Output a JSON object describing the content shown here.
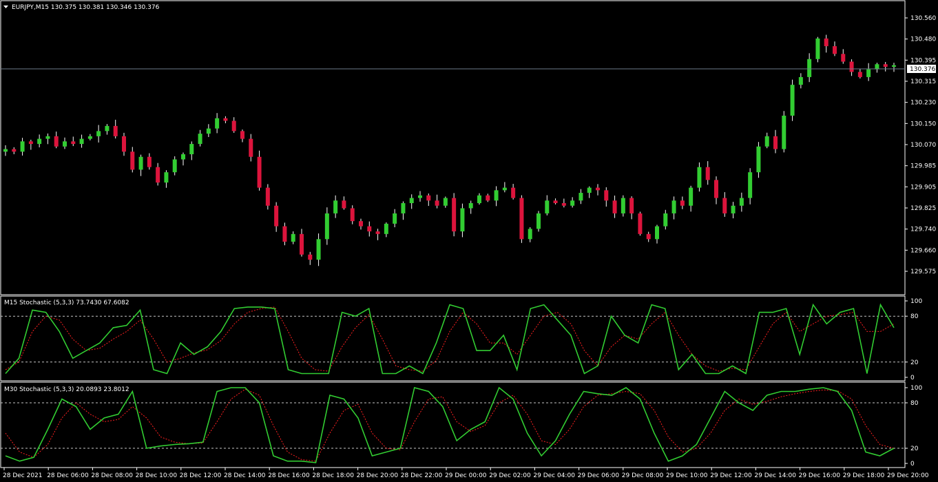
{
  "main_panel": {
    "title": "EURJPY,M15  130.375 130.381 130.346 130.376",
    "price_ticks": [
      "130.560",
      "130.480",
      "130.395",
      "130.315",
      "130.230",
      "130.150",
      "130.070",
      "129.985",
      "129.905",
      "129.825",
      "129.740",
      "129.660",
      "129.575"
    ],
    "current_price_label": "130.376"
  },
  "stoch_m15": {
    "title": "M15 Stochastic (5,3,3) 73.7430 67.6082",
    "levels": [
      "100",
      "80",
      "20",
      "0"
    ]
  },
  "stoch_m30": {
    "title": "M30 Stochastic (5,3,3) 20.0893 23.8012",
    "levels": [
      "100",
      "80",
      "20",
      "0"
    ]
  },
  "time_axis": [
    "28 Dec 2021",
    "28 Dec 06:00",
    "28 Dec 08:00",
    "28 Dec 10:00",
    "28 Dec 12:00",
    "28 Dec 14:00",
    "28 Dec 16:00",
    "28 Dec 18:00",
    "28 Dec 20:00",
    "28 Dec 22:00",
    "29 Dec 00:00",
    "29 Dec 02:00",
    "29 Dec 04:00",
    "29 Dec 06:00",
    "29 Dec 08:00",
    "29 Dec 10:00",
    "29 Dec 12:00",
    "29 Dec 14:00",
    "29 Dec 16:00",
    "29 Dec 18:00",
    "29 Dec 20:00"
  ],
  "colors": {
    "background": "#000000",
    "frame": "#ffffff",
    "grid": "#3a3f4e",
    "bull": "#32cd32",
    "bear": "#dc143c",
    "stoch_main": "#32cd32",
    "stoch_signal": "#ff2020"
  },
  "chart_data": {
    "type": "candlestick",
    "symbol": "EURJPY",
    "timeframe": "M15",
    "ohlc_close_path": [
      130.05,
      130.04,
      130.08,
      130.07,
      130.09,
      130.1,
      130.06,
      130.08,
      130.07,
      130.09,
      130.1,
      130.12,
      130.14,
      130.1,
      130.04,
      129.97,
      130.02,
      129.98,
      129.92,
      129.96,
      130.01,
      130.03,
      130.07,
      130.11,
      130.13,
      130.17,
      130.16,
      130.12,
      130.09,
      130.02,
      129.9,
      129.83,
      129.75,
      129.69,
      129.72,
      129.64,
      129.62,
      129.7,
      129.8,
      129.85,
      129.82,
      129.77,
      129.75,
      129.73,
      129.72,
      129.76,
      129.8,
      129.84,
      129.86,
      129.87,
      129.85,
      129.83,
      129.86,
      129.73,
      129.82,
      129.84,
      129.87,
      129.85,
      129.89,
      129.9,
      129.86,
      129.7,
      129.74,
      129.8,
      129.85,
      129.84,
      129.83,
      129.85,
      129.88,
      129.9,
      129.89,
      129.85,
      129.8,
      129.86,
      129.8,
      129.72,
      129.7,
      129.75,
      129.8,
      129.85,
      129.83,
      129.9,
      129.98,
      129.93,
      129.86,
      129.8,
      129.83,
      129.86,
      129.96,
      130.06,
      130.1,
      130.05,
      130.18,
      130.3,
      130.33,
      130.4,
      130.48,
      130.45,
      130.42,
      130.39,
      130.35,
      130.33,
      130.36,
      130.38,
      130.37,
      130.376
    ],
    "price_range": [
      129.575,
      130.56
    ],
    "stoch_m15_main": [
      5,
      25,
      88,
      85,
      60,
      25,
      35,
      45,
      65,
      68,
      88,
      10,
      5,
      45,
      30,
      40,
      60,
      90,
      92,
      92,
      90,
      10,
      5,
      5,
      5,
      85,
      80,
      90,
      5,
      5,
      15,
      5,
      45,
      95,
      90,
      35,
      35,
      55,
      10,
      90,
      95,
      75,
      55,
      5,
      15,
      80,
      55,
      45,
      95,
      90,
      10,
      30,
      5,
      5,
      15,
      5,
      85,
      85,
      90,
      30,
      95,
      70,
      85,
      90,
      5,
      95,
      65
    ],
    "stoch_m15_signal": [
      10,
      20,
      60,
      80,
      75,
      50,
      35,
      38,
      50,
      60,
      75,
      50,
      20,
      25,
      32,
      36,
      48,
      70,
      85,
      90,
      92,
      60,
      25,
      10,
      8,
      40,
      65,
      82,
      50,
      15,
      10,
      8,
      22,
      60,
      85,
      70,
      45,
      45,
      30,
      55,
      80,
      85,
      70,
      35,
      15,
      40,
      55,
      50,
      70,
      85,
      55,
      30,
      15,
      8,
      12,
      10,
      40,
      70,
      85,
      60,
      70,
      80,
      82,
      85,
      60,
      60,
      70
    ],
    "stoch_m30_main": [
      10,
      3,
      8,
      45,
      85,
      75,
      45,
      60,
      65,
      95,
      20,
      23,
      25,
      26,
      28,
      95,
      100,
      100,
      80,
      10,
      3,
      3,
      1,
      90,
      85,
      60,
      10,
      15,
      20,
      100,
      95,
      75,
      30,
      45,
      55,
      100,
      85,
      40,
      10,
      30,
      65,
      95,
      92,
      90,
      100,
      85,
      40,
      3,
      10,
      25,
      60,
      95,
      80,
      70,
      90,
      95,
      95,
      98,
      100,
      95,
      70,
      15,
      10,
      20
    ],
    "stoch_m30_signal": [
      40,
      15,
      8,
      25,
      60,
      80,
      65,
      55,
      58,
      75,
      60,
      35,
      28,
      26,
      27,
      55,
      85,
      98,
      90,
      50,
      15,
      5,
      3,
      40,
      70,
      78,
      40,
      20,
      18,
      55,
      85,
      88,
      55,
      42,
      50,
      80,
      90,
      65,
      30,
      25,
      45,
      75,
      90,
      92,
      95,
      92,
      70,
      35,
      15,
      20,
      40,
      70,
      85,
      78,
      82,
      88,
      92,
      95,
      97,
      96,
      85,
      50,
      25,
      20
    ],
    "stoch_params": "(5,3,3)",
    "levels": [
      20,
      80
    ]
  }
}
